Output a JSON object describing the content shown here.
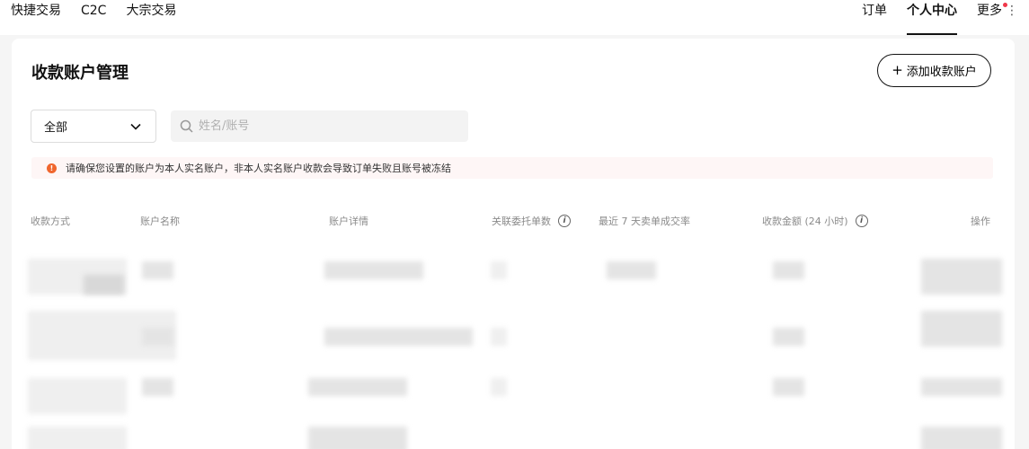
{
  "nav": {
    "left": [
      "快捷交易",
      "C2C",
      "大宗交易"
    ],
    "right": {
      "orders": "订单",
      "personal_center": "个人中心",
      "more": "更多"
    },
    "kebab": "⋮"
  },
  "page": {
    "title": "收款账户管理",
    "add_button": "添加收款账户",
    "filter_selected": "全部",
    "search_placeholder": "姓名/账号",
    "notice": "请确保您设置的账户为本人实名账户，非本人实名账户收款会导致订单失败且账号被冻结"
  },
  "table": {
    "columns": [
      "收款方式",
      "账户名称",
      "账户详情",
      "关联委托单数",
      "最近 7 天卖单成交率",
      "收款金额 (24 小时)",
      "操作"
    ]
  },
  "colors": {
    "accent": "#121212",
    "warning": "#f0662e",
    "badge": "#f0384a"
  },
  "icons": {
    "search": "search-icon",
    "chevron": "chevron-down-icon",
    "warning": "warning-icon",
    "info": "info-icon",
    "plus": "plus-icon"
  }
}
